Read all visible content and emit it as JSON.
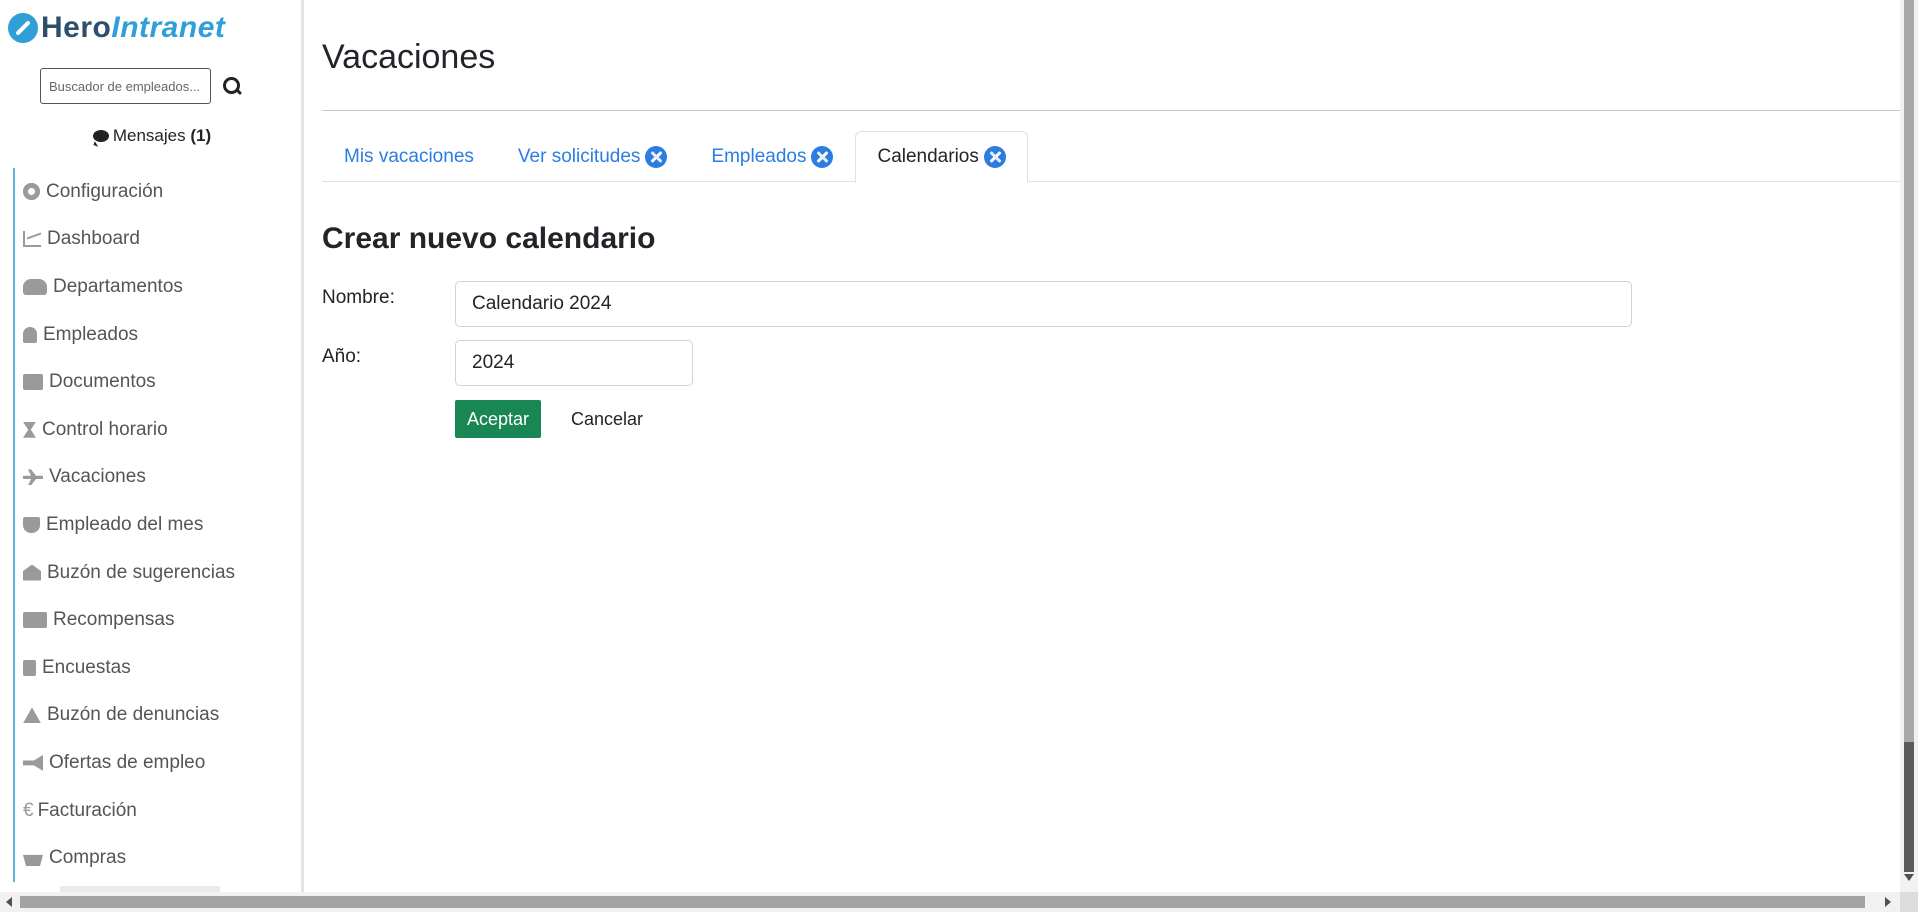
{
  "brand": {
    "name_part1": "Hero",
    "name_part2": "Intranet",
    "primary_color": "#2f9fd8",
    "dark_color": "#2e4f6b"
  },
  "search": {
    "placeholder": "Buscador de empleados..."
  },
  "messages": {
    "label": "Mensajes",
    "count": "(1)"
  },
  "sidebar": {
    "items": [
      {
        "label": "Configuración",
        "icon": "gear-icon"
      },
      {
        "label": "Dashboard",
        "icon": "chart-line-icon"
      },
      {
        "label": "Departamentos",
        "icon": "users-icon"
      },
      {
        "label": "Empleados",
        "icon": "user-icon"
      },
      {
        "label": "Documentos",
        "icon": "folder-icon"
      },
      {
        "label": "Control horario",
        "icon": "hourglass-icon"
      },
      {
        "label": "Vacaciones",
        "icon": "plane-icon"
      },
      {
        "label": "Empleado del mes",
        "icon": "trophy-icon"
      },
      {
        "label": "Buzón de sugerencias",
        "icon": "envelope-open-icon"
      },
      {
        "label": "Recompensas",
        "icon": "gifts-icon"
      },
      {
        "label": "Encuestas",
        "icon": "clipboard-list-icon"
      },
      {
        "label": "Buzón de denuncias",
        "icon": "warning-icon"
      },
      {
        "label": "Ofertas de empleo",
        "icon": "bullhorn-icon"
      },
      {
        "label": "Facturación",
        "icon": "euro-icon"
      },
      {
        "label": "Compras",
        "icon": "basket-icon"
      }
    ]
  },
  "page": {
    "title": "Vacaciones"
  },
  "tabs": [
    {
      "label": "Mis vacaciones",
      "has_tool_icon": false,
      "active": false
    },
    {
      "label": "Ver solicitudes",
      "has_tool_icon": true,
      "active": false
    },
    {
      "label": "Empleados",
      "has_tool_icon": true,
      "active": false
    },
    {
      "label": "Calendarios",
      "has_tool_icon": true,
      "active": true
    }
  ],
  "form": {
    "title": "Crear nuevo calendario",
    "name_label": "Nombre:",
    "name_value": "Calendario 2024",
    "year_label": "Año:",
    "year_value": "2024",
    "accept_label": "Aceptar",
    "cancel_label": "Cancelar",
    "accept_color": "#198754"
  },
  "colors": {
    "link": "#2b7de1",
    "sidebar_accent": "#5fb4e0"
  }
}
